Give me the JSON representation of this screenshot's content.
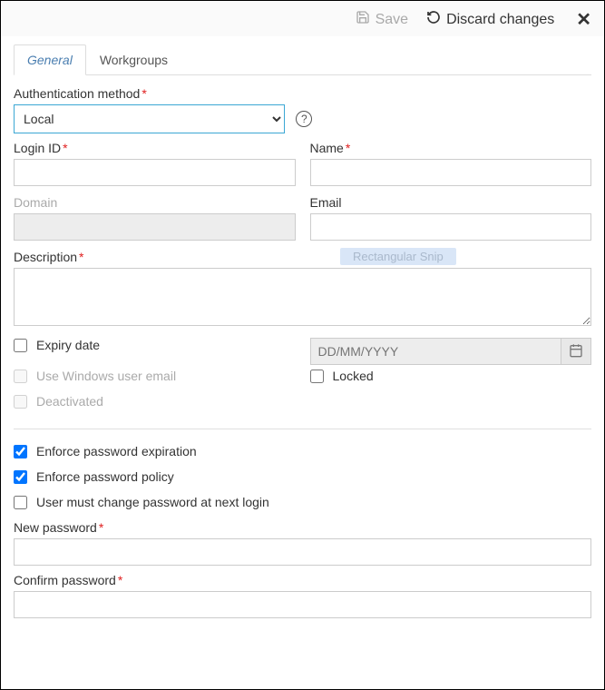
{
  "toolbar": {
    "save_label": "Save",
    "discard_label": "Discard changes"
  },
  "tabs": {
    "general": "General",
    "workgroups": "Workgroups"
  },
  "form": {
    "auth_method_label": "Authentication method",
    "auth_method_value": "Local",
    "auth_method_options": [
      "Local"
    ],
    "login_id_label": "Login ID",
    "login_id_value": "",
    "name_label": "Name",
    "name_value": "",
    "domain_label": "Domain",
    "domain_value": "",
    "email_label": "Email",
    "email_value": "",
    "description_label": "Description",
    "description_value": "",
    "snip_badge": "Rectangular Snip",
    "expiry_date_label": "Expiry date",
    "expiry_date_checked": false,
    "expiry_date_placeholder": "DD/MM/YYYY",
    "expiry_date_value": "",
    "use_windows_email_label": "Use Windows user email",
    "use_windows_email_checked": false,
    "locked_label": "Locked",
    "locked_checked": false,
    "deactivated_label": "Deactivated",
    "deactivated_checked": false,
    "enforce_expiration_label": "Enforce password expiration",
    "enforce_expiration_checked": true,
    "enforce_policy_label": "Enforce password policy",
    "enforce_policy_checked": true,
    "must_change_label": "User must change password at next login",
    "must_change_checked": false,
    "new_password_label": "New password",
    "new_password_value": "",
    "confirm_password_label": "Confirm password",
    "confirm_password_value": ""
  }
}
